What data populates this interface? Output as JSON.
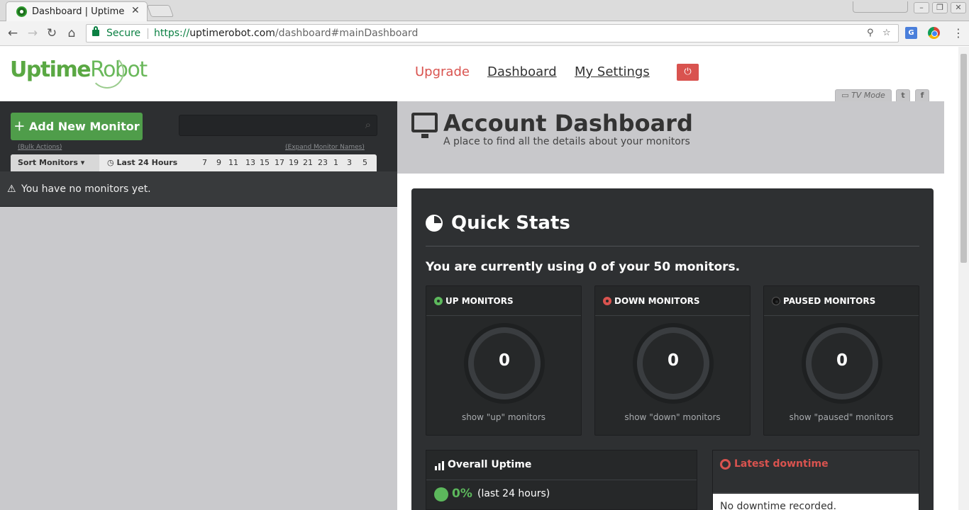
{
  "browser": {
    "tab_title": "Dashboard | Uptime",
    "tab_close": "✕",
    "secure_label": "Secure",
    "url_scheme": "https://",
    "url_host": "uptimerobot.com",
    "url_path": "/dashboard#mainDashboard"
  },
  "header": {
    "logo_bold": "Uptime",
    "logo_light": "Robot",
    "nav": {
      "upgrade": "Upgrade",
      "dashboard": "Dashboard",
      "settings": "My Settings"
    },
    "tv_mode": "TV Mode"
  },
  "sidebar": {
    "add_button": "Add New Monitor",
    "bulk_actions": "(Bulk Actions)",
    "expand_names": "(Expand Monitor Names)",
    "sort_label": "Sort Monitors",
    "range_label": "Last 24 Hours",
    "hours": [
      "7",
      "9",
      "11",
      "13",
      "15",
      "17",
      "19",
      "21",
      "23",
      "1",
      "3",
      "5"
    ],
    "empty_message": "You have no monitors yet."
  },
  "banner": {
    "title": "Account Dashboard",
    "subtitle": "A place to find all the details about your monitors"
  },
  "quick_stats": {
    "title": "Quick Stats",
    "usage_text": "You are currently using 0 of your 50 monitors.",
    "cards": [
      {
        "title": "UP MONITORS",
        "value": "0",
        "footer": "show \"up\" monitors",
        "color": "#5cb85c"
      },
      {
        "title": "DOWN MONITORS",
        "value": "0",
        "footer": "show \"down\" monitors",
        "color": "#d9534f"
      },
      {
        "title": "PAUSED MONITORS",
        "value": "0",
        "footer": "show \"paused\" monitors",
        "color": "#111111"
      }
    ],
    "overall_uptime": {
      "title": "Overall Uptime",
      "value": "0%",
      "period": "(last 24 hours)"
    },
    "latest_downtime": {
      "title": "Latest downtime",
      "message": "No downtime recorded."
    }
  },
  "colors": {
    "brand_green": "#5aa843",
    "danger": "#d9534f",
    "success": "#5cb85c"
  }
}
